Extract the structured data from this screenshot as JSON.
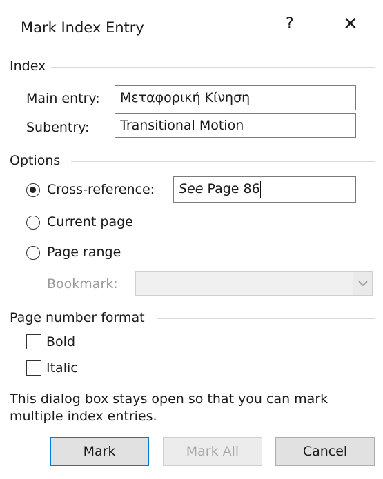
{
  "dialog": {
    "title": "Mark Index Entry",
    "help": "?",
    "close": "✕"
  },
  "index": {
    "heading": "Index",
    "main_entry_label": "Main entry:",
    "main_entry_value": "Μεταφορική Κίνηση",
    "subentry_label": "Subentry:",
    "subentry_value": "Transitional Motion"
  },
  "options": {
    "heading": "Options",
    "cross_reference_label": "Cross-reference:",
    "cross_reference_prefix": "See",
    "cross_reference_value": " Page 86",
    "current_page_label": "Current page",
    "page_range_label": "Page range",
    "bookmark_label": "Bookmark:",
    "selected": "cross-reference"
  },
  "page_number_format": {
    "heading": "Page number format",
    "bold_label": "Bold",
    "italic_label": "Italic"
  },
  "info_text_line1": "This dialog box stays open so that you can mark",
  "info_text_line2": "multiple index entries.",
  "buttons": {
    "mark": "Mark",
    "mark_all": "Mark All",
    "cancel": "Cancel"
  }
}
